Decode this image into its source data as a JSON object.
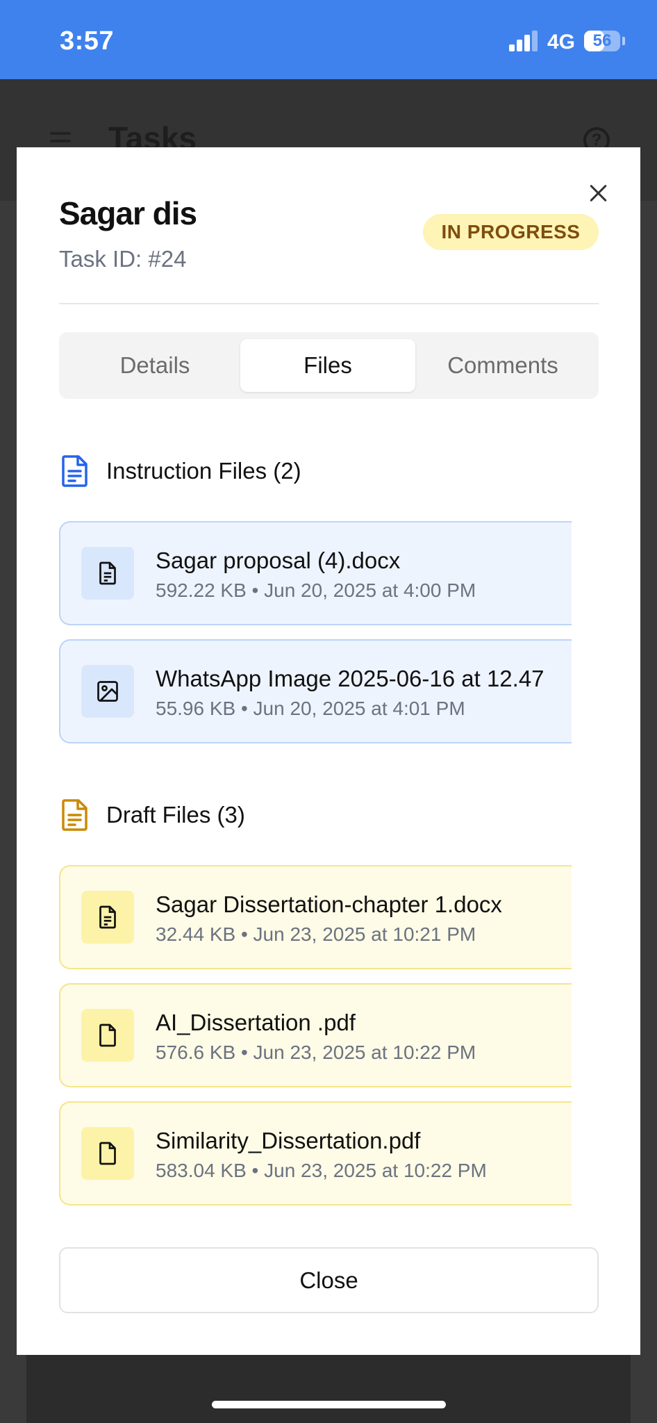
{
  "status_bar": {
    "time": "3:57",
    "network": "4G",
    "battery": "56",
    "battery_level": 0.56,
    "signal_bars": 3
  },
  "background": {
    "title": "Tasks"
  },
  "modal": {
    "title": "Sagar dis",
    "task_id": "Task ID: #24",
    "status": "IN PROGRESS",
    "tabs": [
      {
        "label": "Details",
        "active": false
      },
      {
        "label": "Files",
        "active": true
      },
      {
        "label": "Comments",
        "active": false
      }
    ],
    "instruction_files": {
      "heading": "Instruction Files (2)",
      "items": [
        {
          "name": "Sagar proposal (4).docx",
          "meta": "592.22 KB • Jun 20, 2025 at 4:00 PM",
          "icon": "document-icon"
        },
        {
          "name": "WhatsApp Image 2025-06-16 at 12.47",
          "meta": "55.96 KB • Jun 20, 2025 at 4:01 PM",
          "icon": "image-icon"
        }
      ]
    },
    "draft_files": {
      "heading": "Draft Files (3)",
      "items": [
        {
          "name": "Sagar Dissertation-chapter 1.docx",
          "meta": "32.44 KB • Jun 23, 2025 at 10:21 PM",
          "icon": "document-icon"
        },
        {
          "name": "AI_Dissertation .pdf",
          "meta": "576.6 KB • Jun 23, 2025 at 10:22 PM",
          "icon": "file-icon"
        },
        {
          "name": "Similarity_Dissertation.pdf",
          "meta": "583.04 KB • Jun 23, 2025 at 10:22 PM",
          "icon": "file-icon"
        }
      ]
    },
    "close_label": "Close"
  },
  "colors": {
    "status_bar": "#3f82ee",
    "badge_bg": "#fdf4b5",
    "badge_text": "#7f4d0f",
    "instruction_accent": "#2563eb",
    "draft_accent": "#ca8a04"
  }
}
